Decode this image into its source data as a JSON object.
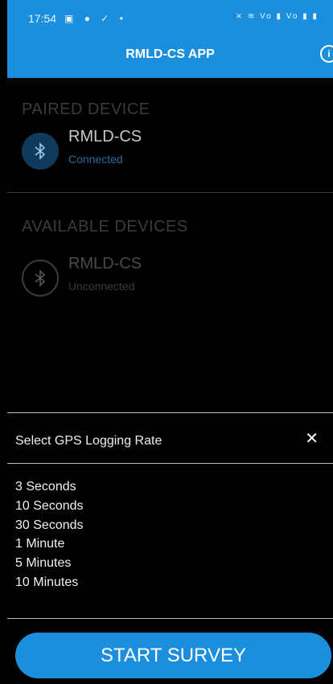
{
  "status_bar": {
    "time": "17:54",
    "left_icons": "▣ ● ✓ •",
    "right_icons": "⨯ ≋ Vo ▮ Vo ▮ ▮"
  },
  "header": {
    "title": "RMLD-CS APP",
    "info_icon": "info-icon"
  },
  "paired": {
    "heading": "PAIRED DEVICE",
    "device": {
      "name": "RMLD-CS",
      "status": "Connected",
      "icon": "bluetooth-icon"
    }
  },
  "available": {
    "heading": "AVAILABLE DEVICES",
    "device": {
      "name": "RMLD-CS",
      "status": "Unconnected",
      "icon": "bluetooth-icon"
    }
  },
  "gps_picker": {
    "title": "Select GPS Logging Rate",
    "close": "✕",
    "options": [
      "3 Seconds",
      "10 Seconds",
      "30 Seconds",
      "1 Minute",
      "5 Minutes",
      "10 Minutes"
    ]
  },
  "footer": {
    "start_label": "START SURVEY"
  },
  "colors": {
    "accent": "#1b8fdd",
    "connected": "#2a6aa0",
    "muted": "#3b3b3b"
  }
}
